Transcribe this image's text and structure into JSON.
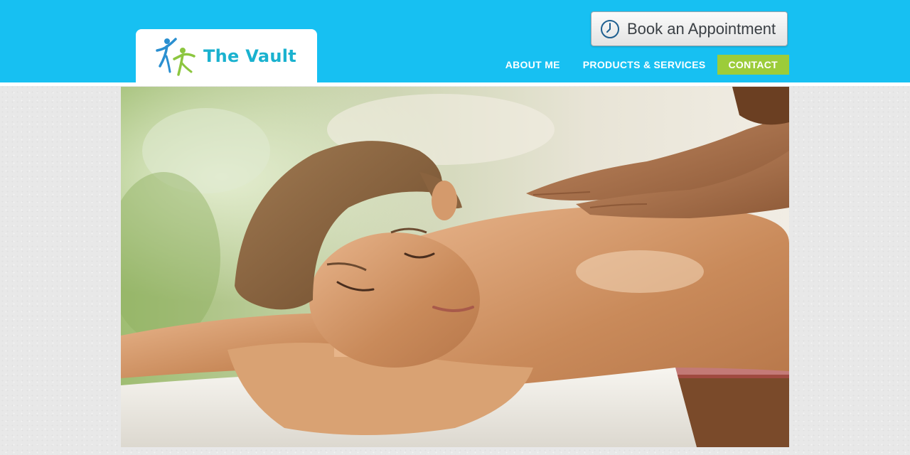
{
  "brand": {
    "name": "The Vault",
    "logo_icon": "dancing-figures-logo",
    "primary_color": "#17c0f2",
    "logo_text_color": "#1ab2cf",
    "accent_color": "#9ccc3a"
  },
  "header": {
    "book_button": {
      "label": "Book an Appointment",
      "icon": "clock-icon"
    }
  },
  "nav": {
    "items": [
      {
        "label": "ABOUT ME",
        "active": false
      },
      {
        "label": "PRODUCTS & SERVICES",
        "active": false
      },
      {
        "label": "CONTACT",
        "active": true
      }
    ]
  },
  "hero": {
    "image": "massage-photo"
  }
}
